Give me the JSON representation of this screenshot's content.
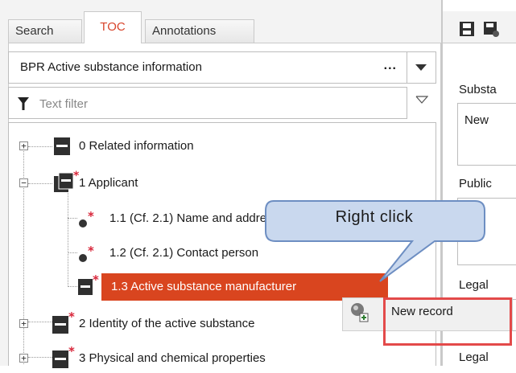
{
  "tabs": [
    {
      "label": "Search"
    },
    {
      "label": "TOC"
    },
    {
      "label": "Annotations"
    }
  ],
  "document_selector": {
    "value": "BPR Active substance information",
    "more": "..."
  },
  "filter": {
    "placeholder": "Text filter"
  },
  "tree": [
    {
      "label": "0 Related information"
    },
    {
      "label": "1 Applicant"
    },
    {
      "label": "1.1 (Cf. 2.1) Name and address"
    },
    {
      "label": "1.2 (Cf. 2.1) Contact person"
    },
    {
      "label": "1.3 Active substance manufacturer"
    },
    {
      "label": "2 Identity of the active substance"
    },
    {
      "label": "3 Physical and chemical properties"
    }
  ],
  "right_panel": {
    "labels": [
      "Substa",
      "Public",
      "Legal",
      "Legal"
    ],
    "value": "New"
  },
  "callout": {
    "text": "Right click"
  },
  "context_menu": {
    "item": "New record"
  },
  "colors": {
    "accent": "#d9451f",
    "highlight_box": "#e34a4a",
    "callout_fill": "#c9d8ee",
    "callout_border": "#6d8ec2"
  }
}
